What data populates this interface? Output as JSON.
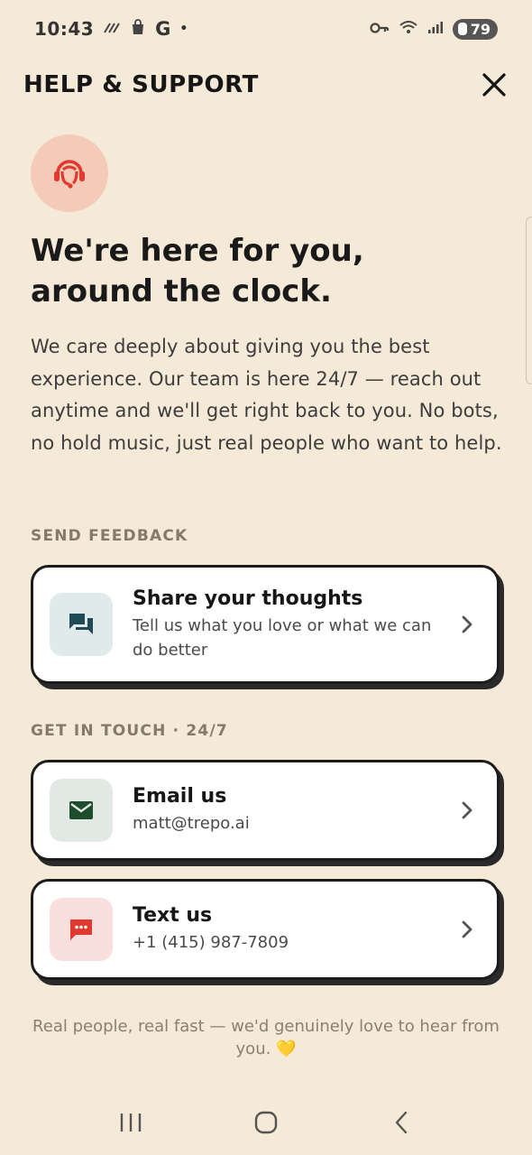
{
  "status_bar": {
    "time": "10:43",
    "g_label": "G",
    "dot": "•",
    "battery": "79"
  },
  "header": {
    "title": "HELP & SUPPORT"
  },
  "hero": {
    "title_line1": "We're here for you,",
    "title_line2": "around the clock.",
    "intro": "We care deeply about giving you the best experience. Our team is here 24/7 — reach out anytime and we'll get right back to you. No bots, no hold music, just real people who want to help."
  },
  "feedback": {
    "section_label": "SEND FEEDBACK",
    "card": {
      "title": "Share your thoughts",
      "subtitle": "Tell us what you love or what we can do better",
      "icon": "chat-bubbles-icon"
    }
  },
  "contact": {
    "section_label": "GET IN TOUCH · 24/7",
    "email": {
      "title": "Email us",
      "subtitle": "matt@trepo.ai",
      "icon": "envelope-icon"
    },
    "text": {
      "title": "Text us",
      "subtitle": "+1 (415) 987-7809",
      "icon": "sms-icon"
    }
  },
  "footer": {
    "note": "Real people, real fast — we'd genuinely love to hear from you. 💛"
  },
  "colors": {
    "background": "#f5e9d7",
    "accent_red": "#e03a2f",
    "hero_icon_bg": "#f3cbb8",
    "feedback_icon_bg": "#e0eaea",
    "feedback_icon_fg": "#1f4a56",
    "email_icon_bg": "#e2e8e3",
    "email_icon_fg": "#1e4d2e",
    "text_icon_bg": "#f9e0de",
    "text_icon_fg": "#e03a2f"
  }
}
